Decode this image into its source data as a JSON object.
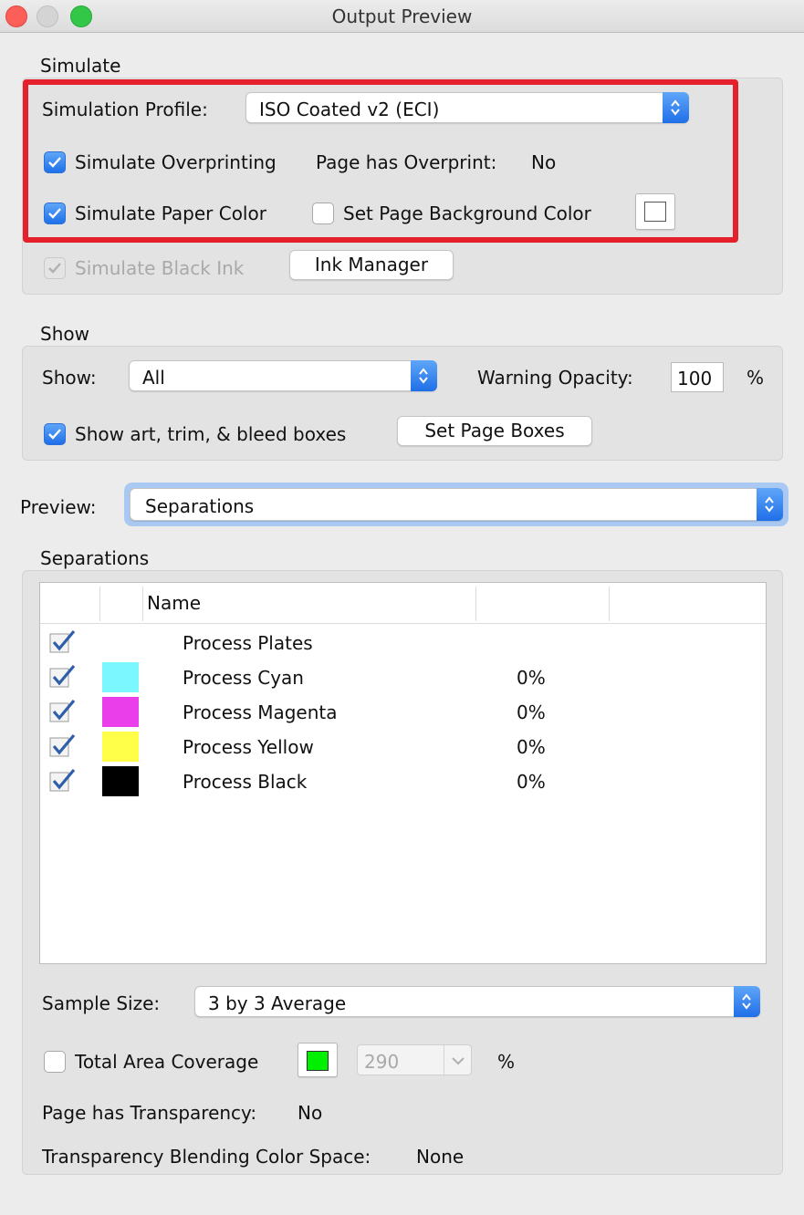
{
  "window": {
    "title": "Output Preview"
  },
  "simulate": {
    "section_title": "Simulate",
    "profile_label": "Simulation Profile:",
    "profile_value": "ISO Coated v2 (ECI)",
    "overprinting_label": "Simulate Overprinting",
    "page_overprint_label": "Page has Overprint:",
    "page_overprint_value": "No",
    "paper_color_label": "Simulate Paper Color",
    "page_bg_label": "Set Page Background Color",
    "black_ink_label": "Simulate Black Ink",
    "ink_manager_label": "Ink Manager"
  },
  "show": {
    "section_title": "Show",
    "show_label": "Show:",
    "show_value": "All",
    "warning_opacity_label": "Warning Opacity:",
    "warning_opacity_value": "100",
    "percent_symbol": "%",
    "boxes_label": "Show art, trim, & bleed boxes",
    "set_page_boxes_label": "Set Page Boxes"
  },
  "preview": {
    "label": "Preview:",
    "value": "Separations"
  },
  "separations": {
    "section_title": "Separations",
    "column_name": "Name",
    "rows": [
      {
        "name": "Process Plates",
        "value": "",
        "swatch": ""
      },
      {
        "name": "Process Cyan",
        "value": "0%",
        "swatch": "#7bf7ff"
      },
      {
        "name": "Process Magenta",
        "value": "0%",
        "swatch": "#e93ee9"
      },
      {
        "name": "Process Yellow",
        "value": "0%",
        "swatch": "#ffff4a"
      },
      {
        "name": "Process Black",
        "value": "0%",
        "swatch": "#000000"
      }
    ],
    "sample_size_label": "Sample Size:",
    "sample_size_value": "3 by 3 Average",
    "tac_label": "Total Area Coverage",
    "tac_value": "290",
    "tac_percent": "%",
    "tac_color": "#00f000",
    "transparency_label": "Page has Transparency:",
    "transparency_value": "No",
    "blending_label": "Transparency Blending Color Space:",
    "blending_value": "None"
  },
  "colors": {
    "accent": "#1f6fe8",
    "highlight": "#e3202b"
  }
}
